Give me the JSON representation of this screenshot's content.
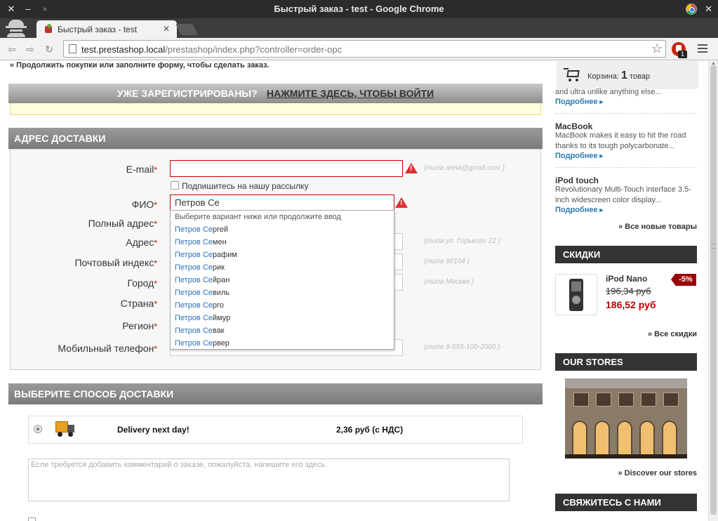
{
  "window": {
    "title": "Быстрый заказ - test - Google Chrome",
    "tab_title": "Быстрый заказ - test",
    "url_host": "test.prestashop.local",
    "url_path": "/prestashop/index.php?controller=order-opc",
    "extension_badge": "1"
  },
  "top": {
    "continue_link": "« Продолжить покупки",
    "continue_rest": "  или заполните форму, чтобы сделать заказ."
  },
  "login": {
    "question": "УЖЕ ЗАРЕГИСТРИРОВАНЫ?",
    "link": "НАЖМИТЕ ЗДЕСЬ, ЧТОБЫ ВОЙТИ"
  },
  "address": {
    "heading": "АДРЕС ДОСТАВКИ",
    "required_mark": "*",
    "newsletter_label": "Подпишитесь на нашу рассылку",
    "fields": {
      "email": {
        "label": "E-mail",
        "hint": "(типа anna@gmail.com )"
      },
      "fio": {
        "label": "ФИО",
        "value": "Петров Се"
      },
      "full_address": {
        "label": "Полный адрес"
      },
      "address": {
        "label": "Адрес",
        "hint": "(типа ул. Горького 22 )"
      },
      "postcode": {
        "label": "Почтовый индекс",
        "hint": "(типа 90104 )"
      },
      "city": {
        "label": "Город",
        "hint": "(типа Москва )"
      },
      "country": {
        "label": "Страна"
      },
      "region": {
        "label": "Регион"
      },
      "phone": {
        "label": "Мобильный телефон",
        "hint": "(типа 8-555-100-2000 )"
      }
    }
  },
  "suggestions": {
    "header": "Выберите вариант ниже или продолжите ввод",
    "items": [
      {
        "match": "Петров Се",
        "rest": "ргей"
      },
      {
        "match": "Петров Се",
        "rest": "мен"
      },
      {
        "match": "Петров Се",
        "rest": "рафим"
      },
      {
        "match": "Петров Се",
        "rest": "рик"
      },
      {
        "match": "Петров Се",
        "rest": "йран"
      },
      {
        "match": "Петров Се",
        "rest": "виль"
      },
      {
        "match": "Петров Се",
        "rest": "рго"
      },
      {
        "match": "Петров Се",
        "rest": "ймур"
      },
      {
        "match": "Петров Се",
        "rest": "вак"
      },
      {
        "match": "Петров Се",
        "rest": "рвер"
      }
    ]
  },
  "shipping": {
    "heading": "ВЫБЕРИТЕ СПОСОБ ДОСТАВКИ",
    "carrier_name": "Delivery next day!",
    "carrier_price": "2,36 руб (с НДС)",
    "comment_placeholder": "Если требуется добавить комментарий о заказе, пожалуйста, напишите его здесь."
  },
  "cart": {
    "label": "Корзина:",
    "count": "1",
    "unit": "товар"
  },
  "new_products": {
    "items": [
      {
        "name": "",
        "desc": "and ultra unlike anything else...",
        "more": "Подробнее"
      },
      {
        "name": "MacBook",
        "desc": "MacBook makes it easy to hit the road thanks to its tough polycarbonate...",
        "more": "Подробнее"
      },
      {
        "name": "iPod touch",
        "desc": "Revolutionary Multi-Touch interface 3.5-inch widescreen color display...",
        "more": "Подробнее"
      }
    ],
    "all_link": "» Все новые товары"
  },
  "specials": {
    "heading": "СКИДКИ",
    "product_name": "iPod Nano",
    "old_price": "196,34 руб",
    "new_price": "186,52 руб",
    "discount": "-5%",
    "all_link": "» Все скидки"
  },
  "stores": {
    "heading": "OUR STORES",
    "link": "» Discover our stores"
  },
  "contact": {
    "heading": "СВЯЖИТЕСЬ С НАМИ"
  },
  "colors": {
    "error": "#cc0000",
    "link_blue": "#2a7ab0",
    "sale_red": "#bb0000",
    "section_gray": "#8a8a8a",
    "sidebar_head": "#333333"
  }
}
